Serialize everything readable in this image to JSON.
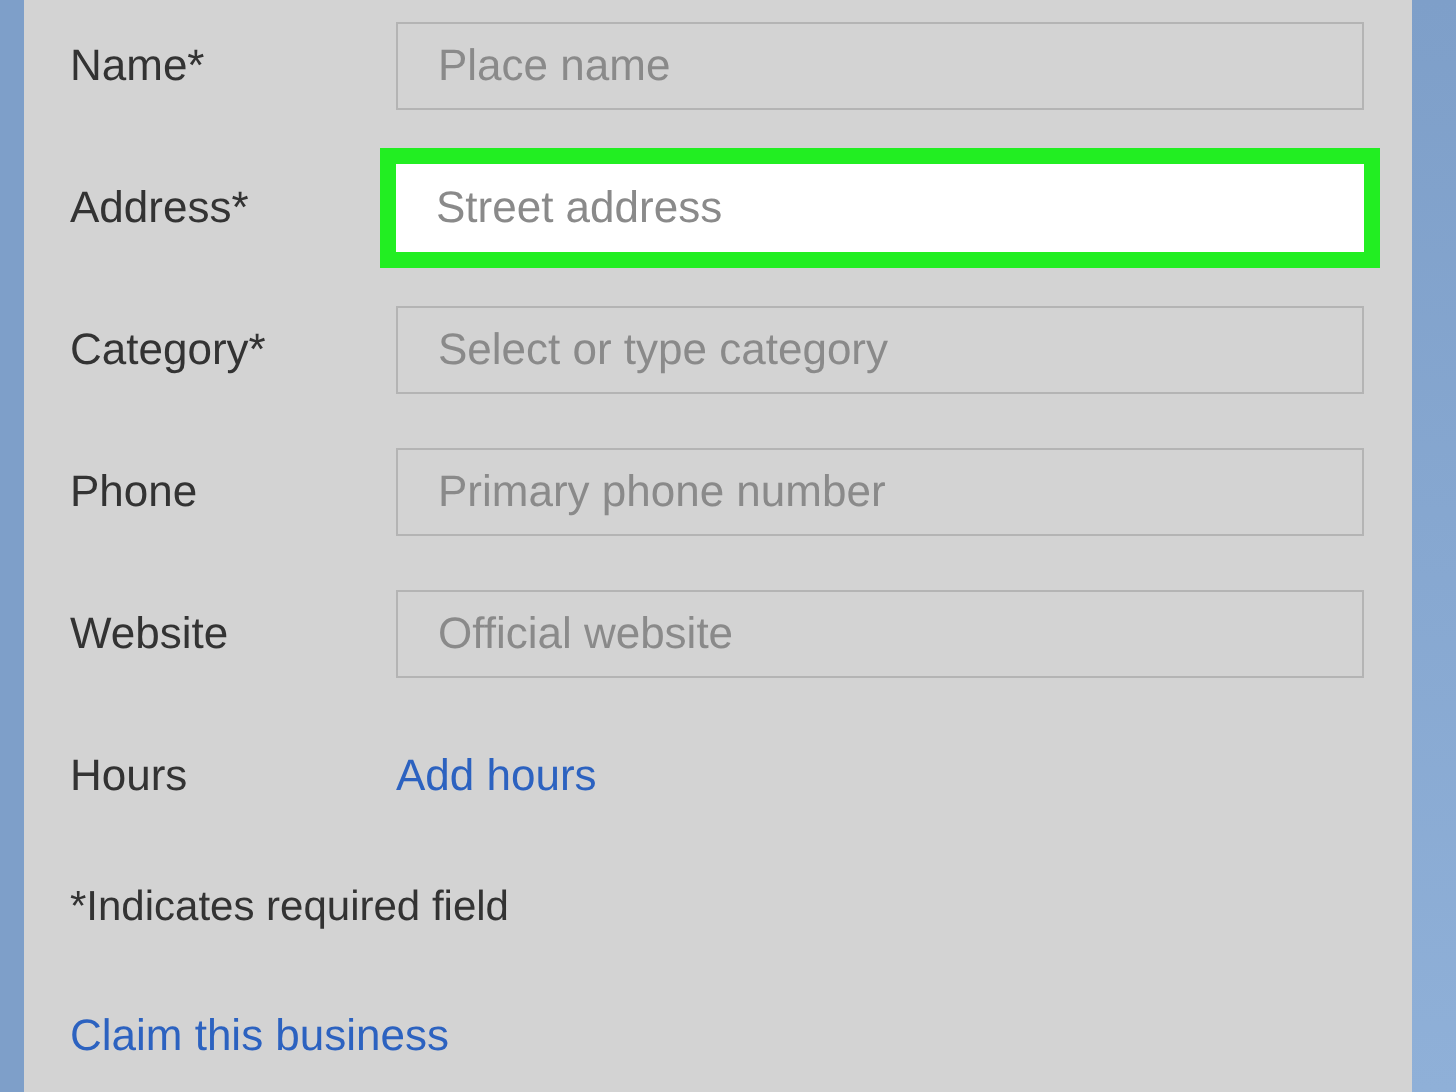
{
  "form": {
    "fields": [
      {
        "label": "Name*",
        "kind": "input",
        "placeholder": "Place name",
        "highlighted": false
      },
      {
        "label": "Address*",
        "kind": "input",
        "placeholder": "Street address",
        "highlighted": true
      },
      {
        "label": "Category*",
        "kind": "input",
        "placeholder": "Select or type category",
        "highlighted": false
      },
      {
        "label": "Phone",
        "kind": "input",
        "placeholder": "Primary phone number",
        "highlighted": false
      },
      {
        "label": "Website",
        "kind": "input",
        "placeholder": "Official website",
        "highlighted": false
      },
      {
        "label": "Hours",
        "kind": "link",
        "link": "Add hours"
      }
    ],
    "note": "*Indicates required field",
    "claim_link": "Claim this business"
  }
}
